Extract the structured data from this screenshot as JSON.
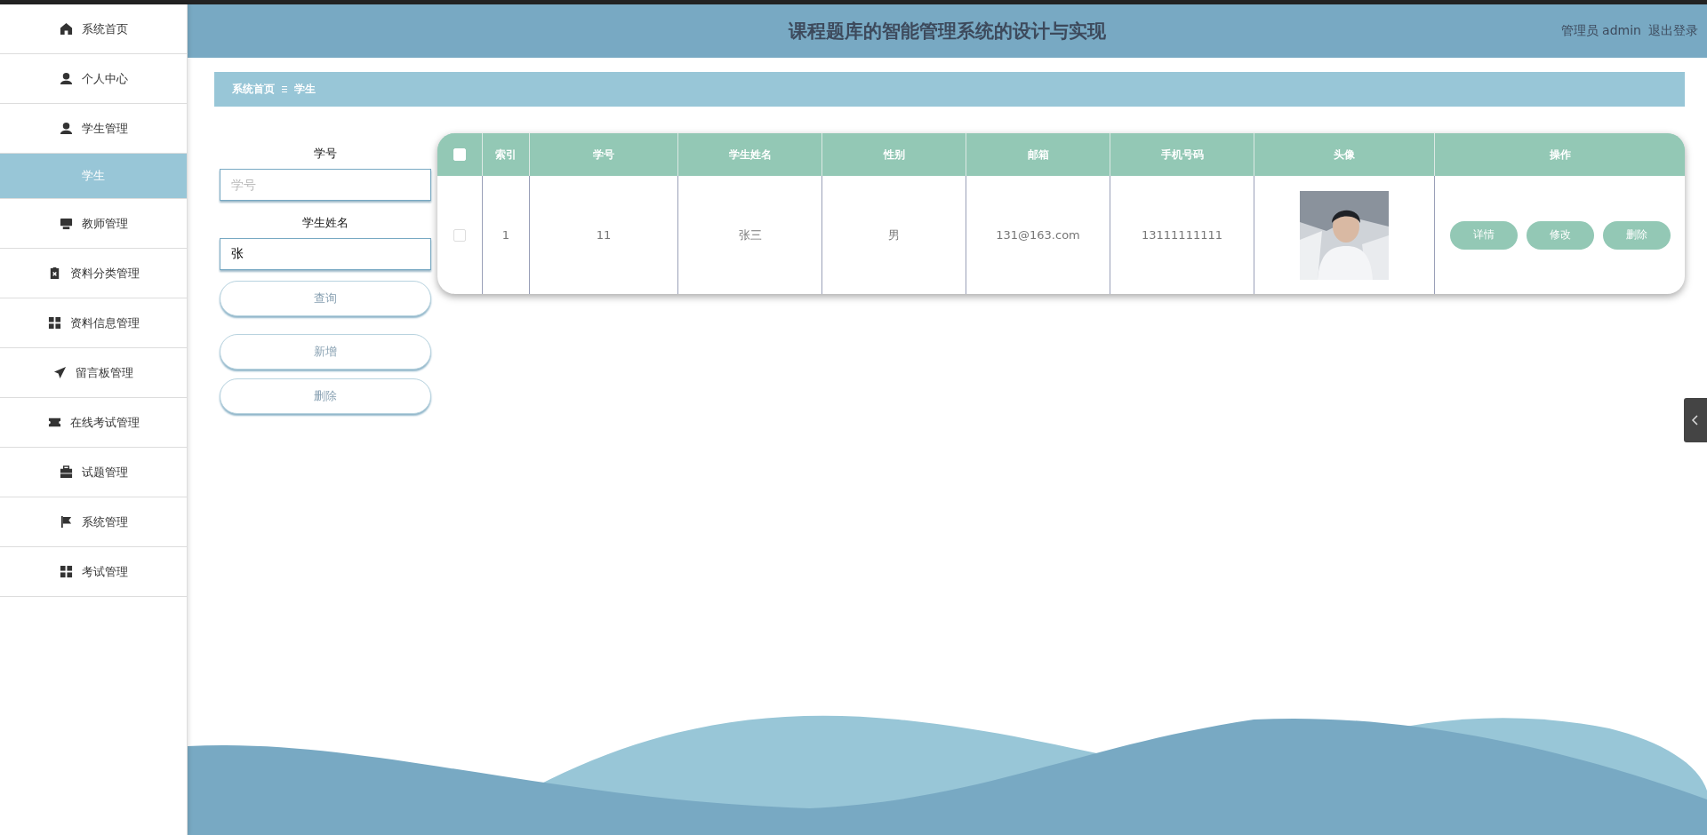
{
  "sidebar": {
    "items": [
      {
        "label": "系统首页",
        "selected": false
      },
      {
        "label": "个人中心",
        "selected": false
      },
      {
        "label": "学生管理",
        "selected": false,
        "expanded": true,
        "children": [
          {
            "label": "学生",
            "selected": true
          }
        ]
      },
      {
        "label": "教师管理",
        "selected": false
      },
      {
        "label": "资料分类管理",
        "selected": false
      },
      {
        "label": "资料信息管理",
        "selected": false
      },
      {
        "label": "留言板管理",
        "selected": false
      },
      {
        "label": "在线考试管理",
        "selected": false
      },
      {
        "label": "试题管理",
        "selected": false
      },
      {
        "label": "系统管理",
        "selected": false
      },
      {
        "label": "考试管理",
        "selected": false
      }
    ]
  },
  "header": {
    "title": "课程题库的智能管理系统的设计与实现",
    "user": "管理员 admin",
    "logout": "退出登录"
  },
  "breadcrumb": [
    "系统首页",
    "学生"
  ],
  "search_form": {
    "fields": [
      {
        "label": "学号",
        "placeholder": "学号"
      },
      {
        "label": "学生姓名",
        "value": "张"
      }
    ],
    "buttons": [
      "查询",
      "新增",
      "删除"
    ]
  },
  "table": {
    "select_all_checked": false,
    "columns": [
      "索引",
      "学号",
      "学生姓名",
      "性别",
      "邮箱",
      "手机号码",
      "头像",
      "操作"
    ],
    "rows": [
      {
        "checked": false,
        "cells": [
          "1",
          "11",
          "张三",
          "男",
          "131@163.com",
          "13111111111"
        ],
        "actions": [
          "详情",
          "修改",
          "删除"
        ]
      }
    ]
  }
}
